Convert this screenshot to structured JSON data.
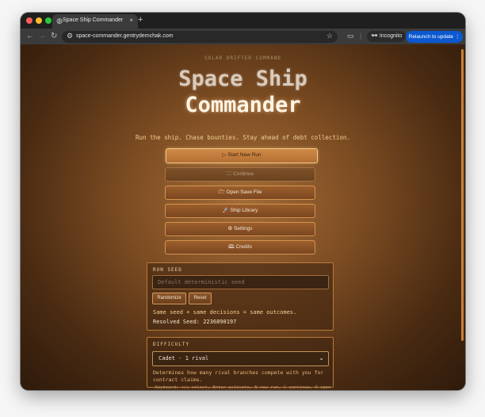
{
  "browser": {
    "tab_title": "Space Ship Commander",
    "tab_close": "×",
    "new_tab": "+",
    "url": "space-commander.gentrydemchak.com",
    "incognito_label": "Incognito",
    "relaunch_label": "Relaunch to update"
  },
  "page": {
    "kicker": "SOLAR DRIFTER COMMAND",
    "title_line1": "Space Ship",
    "title_line2": "Commander",
    "tagline": "Run the ship. Chase bounties. Stay ahead of debt collection.",
    "menu": [
      {
        "icon": "▷",
        "label": "Start New Run"
      },
      {
        "icon": "🗀",
        "label": "Continue"
      },
      {
        "icon": "🗁",
        "label": "Open Save File"
      },
      {
        "icon": "🚀",
        "label": "Ship Library"
      },
      {
        "icon": "⚙",
        "label": "Settings"
      },
      {
        "icon": "🕮",
        "label": "Credits"
      }
    ],
    "run_seed": {
      "label": "RUN SEED",
      "placeholder": "Default deterministic seed",
      "randomize_label": "Randomize",
      "reset_label": "Reset",
      "note": "Same seed + same decisions = same outcomes.",
      "resolved": "Resolved Seed: 2236890197"
    },
    "difficulty": {
      "label": "DIFFICULTY",
      "selected": "Cadet - 1 rival",
      "help": "Determines how many rival branches compete with you for contract claims."
    },
    "footer": "Keyboard: ↑/↓ select, Enter activate, N new run, C continue, O open"
  }
}
